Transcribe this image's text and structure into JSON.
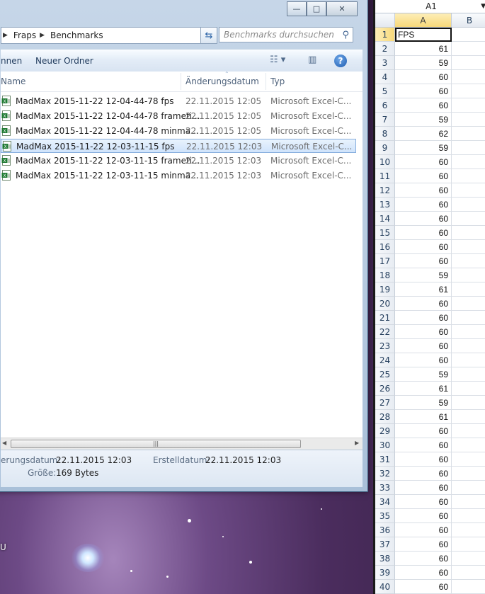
{
  "explorer": {
    "caption": {
      "minimize": "—",
      "maximize": "□",
      "close": "✕"
    },
    "address": {
      "crumbs": [
        "Fraps",
        "Benchmarks"
      ]
    },
    "search_placeholder": "Benchmarks durchsuchen",
    "toolbar": {
      "partial_item": "nnen",
      "new_folder": "Neuer Ordner",
      "help": "?"
    },
    "columns": {
      "name": "Name",
      "date": "Änderungsdatum",
      "type": "Typ"
    },
    "files": [
      {
        "name": "MadMax 2015-11-22 12-04-44-78 fps",
        "date": "22.11.2015 12:05",
        "type": "Microsoft Excel-C...",
        "selected": false
      },
      {
        "name": "MadMax 2015-11-22 12-04-44-78 frameti...",
        "date": "22.11.2015 12:05",
        "type": "Microsoft Excel-C...",
        "selected": false
      },
      {
        "name": "MadMax 2015-11-22 12-04-44-78 minma...",
        "date": "22.11.2015 12:05",
        "type": "Microsoft Excel-C...",
        "selected": false
      },
      {
        "name": "MadMax 2015-11-22 12-03-11-15 fps",
        "date": "22.11.2015 12:03",
        "type": "Microsoft Excel-C...",
        "selected": true
      },
      {
        "name": "MadMax 2015-11-22 12-03-11-15 frameti...",
        "date": "22.11.2015 12:03",
        "type": "Microsoft Excel-C...",
        "selected": false
      },
      {
        "name": "MadMax 2015-11-22 12-03-11-15 minma...",
        "date": "22.11.2015 12:03",
        "type": "Microsoft Excel-C...",
        "selected": false
      }
    ],
    "details": {
      "modified_label": "erungsdatum:",
      "modified_value": "22.11.2015 12:03",
      "created_label": "Erstelldatum:",
      "created_value": "22.11.2015 12:03",
      "size_label": "Größe:",
      "size_value": "169 Bytes"
    }
  },
  "desktop": {
    "partial_text": "U"
  },
  "excel": {
    "name_box": "A1",
    "columns": [
      "A",
      "B"
    ],
    "header_cell": "FPS",
    "values": [
      61,
      59,
      60,
      60,
      60,
      59,
      62,
      59,
      60,
      60,
      60,
      60,
      60,
      60,
      60,
      60,
      59,
      61,
      60,
      60,
      60,
      60,
      60,
      59,
      61,
      59,
      61,
      60,
      60,
      60,
      60,
      60,
      60,
      60,
      60,
      60,
      60,
      60,
      60
    ]
  }
}
